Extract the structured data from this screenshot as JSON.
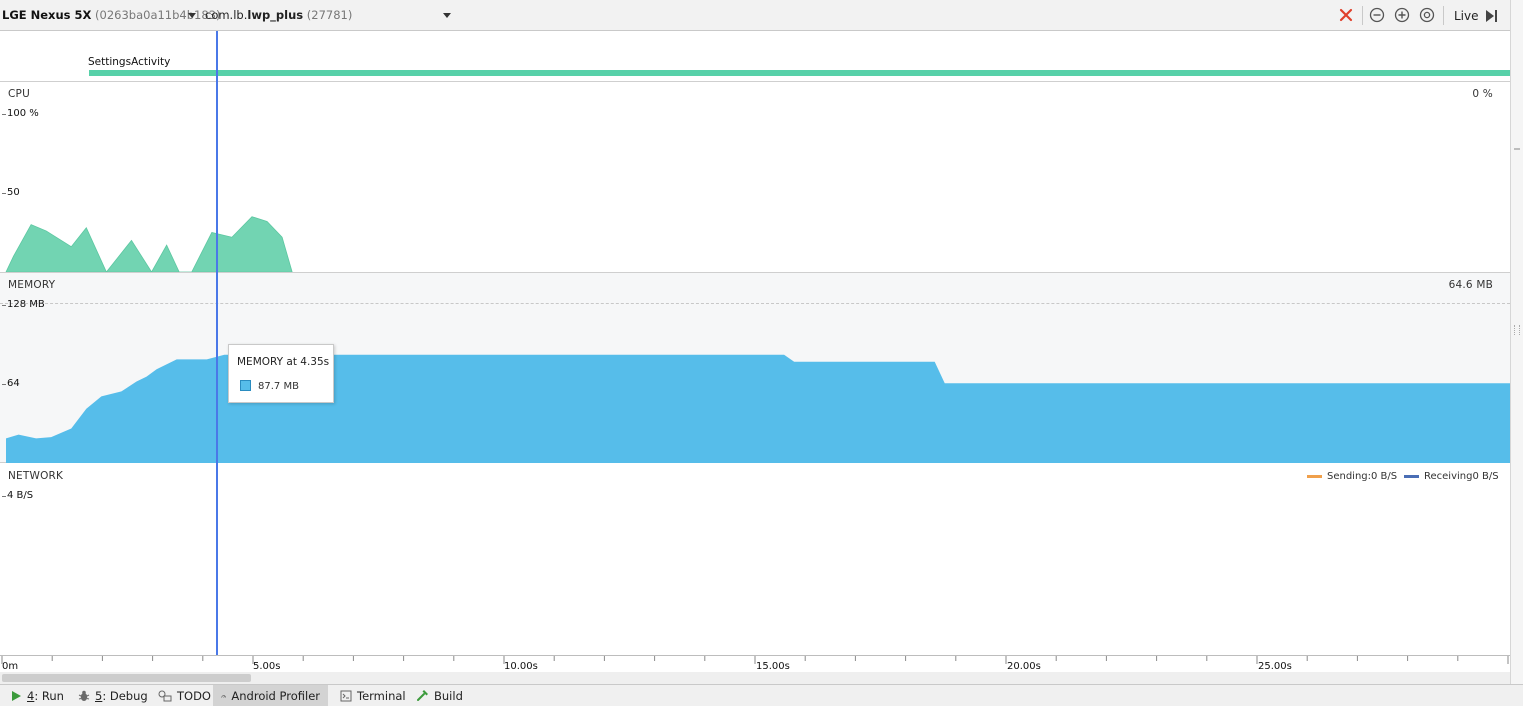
{
  "toolbar": {
    "device_name": "LGE Nexus 5X",
    "device_serial": "(0263ba0a11b4b183)",
    "process_prefix": "com.lb.",
    "process_name": "lwp_plus",
    "process_pid": "(27781)",
    "live_label": "Live"
  },
  "activity": {
    "label": "SettingsActivity"
  },
  "cpu": {
    "title": "CPU",
    "current": "0 %",
    "axis_top": "100 %",
    "axis_mid": "50"
  },
  "memory": {
    "title": "MEMORY",
    "current": "64.6 MB",
    "axis_top": "128 MB",
    "axis_mid": "64"
  },
  "network": {
    "title": "NETWORK",
    "axis_top": "4 B/S",
    "legend_sending": "Sending:0 B/S",
    "legend_receiving": "Receiving0 B/S"
  },
  "tooltip": {
    "title": "MEMORY at 4.35s",
    "value": "87.7 MB"
  },
  "time_axis": {
    "labels": [
      "0m",
      "5.00s",
      "10.00s",
      "15.00s",
      "20.00s",
      "25.00s"
    ]
  },
  "bottom_tabs": {
    "run_key": "4",
    "run_label": ": Run",
    "debug_key": "5",
    "debug_label": ": Debug",
    "todo": "TODO",
    "profiler": "Android Profiler",
    "terminal": "Terminal",
    "build": "Build"
  },
  "colors": {
    "cpu_fill": "#72d4b2",
    "memory_fill": "#56bdea",
    "activity_bar": "#57d1a9",
    "selection_line": "#4a78e8",
    "sending": "#f0a04b",
    "receiving": "#4a6eb5",
    "close_icon": "#e0402b"
  },
  "chart_data": [
    {
      "type": "area",
      "title": "CPU",
      "x_unit": "s",
      "y_unit": "%",
      "ylim": [
        0,
        100
      ],
      "x": [
        0,
        0.15,
        0.5,
        0.8,
        1.3,
        1.6,
        2.0,
        2.5,
        2.9,
        3.2,
        3.45,
        3.7,
        4.1,
        4.5,
        4.9,
        5.2,
        5.5,
        5.7
      ],
      "values": [
        0,
        10,
        30,
        26,
        16,
        28,
        0,
        20,
        0,
        17,
        0,
        0,
        25,
        22,
        35,
        32,
        22,
        0
      ]
    },
    {
      "type": "area",
      "title": "MEMORY",
      "x_unit": "s",
      "y_unit": "MB",
      "ylim": [
        0,
        128
      ],
      "x": [
        0,
        0.25,
        0.6,
        0.9,
        1.3,
        1.6,
        1.9,
        2.3,
        2.6,
        2.8,
        3.0,
        3.4,
        4.0,
        4.35,
        15.5,
        15.7,
        18.5,
        18.7,
        30.0
      ],
      "values": [
        20,
        23,
        20,
        21,
        28,
        44,
        54,
        58,
        66,
        70,
        76,
        84,
        84,
        87.7,
        87.7,
        82,
        82,
        64.6,
        64.6
      ],
      "annotation": "MEMORY at 4.35s: 87.7 MB"
    },
    {
      "type": "line",
      "title": "NETWORK",
      "series": [
        {
          "name": "Sending",
          "values": [
            0
          ]
        },
        {
          "name": "Receiving",
          "values": [
            0
          ]
        }
      ],
      "ylim": [
        0,
        4
      ]
    }
  ]
}
